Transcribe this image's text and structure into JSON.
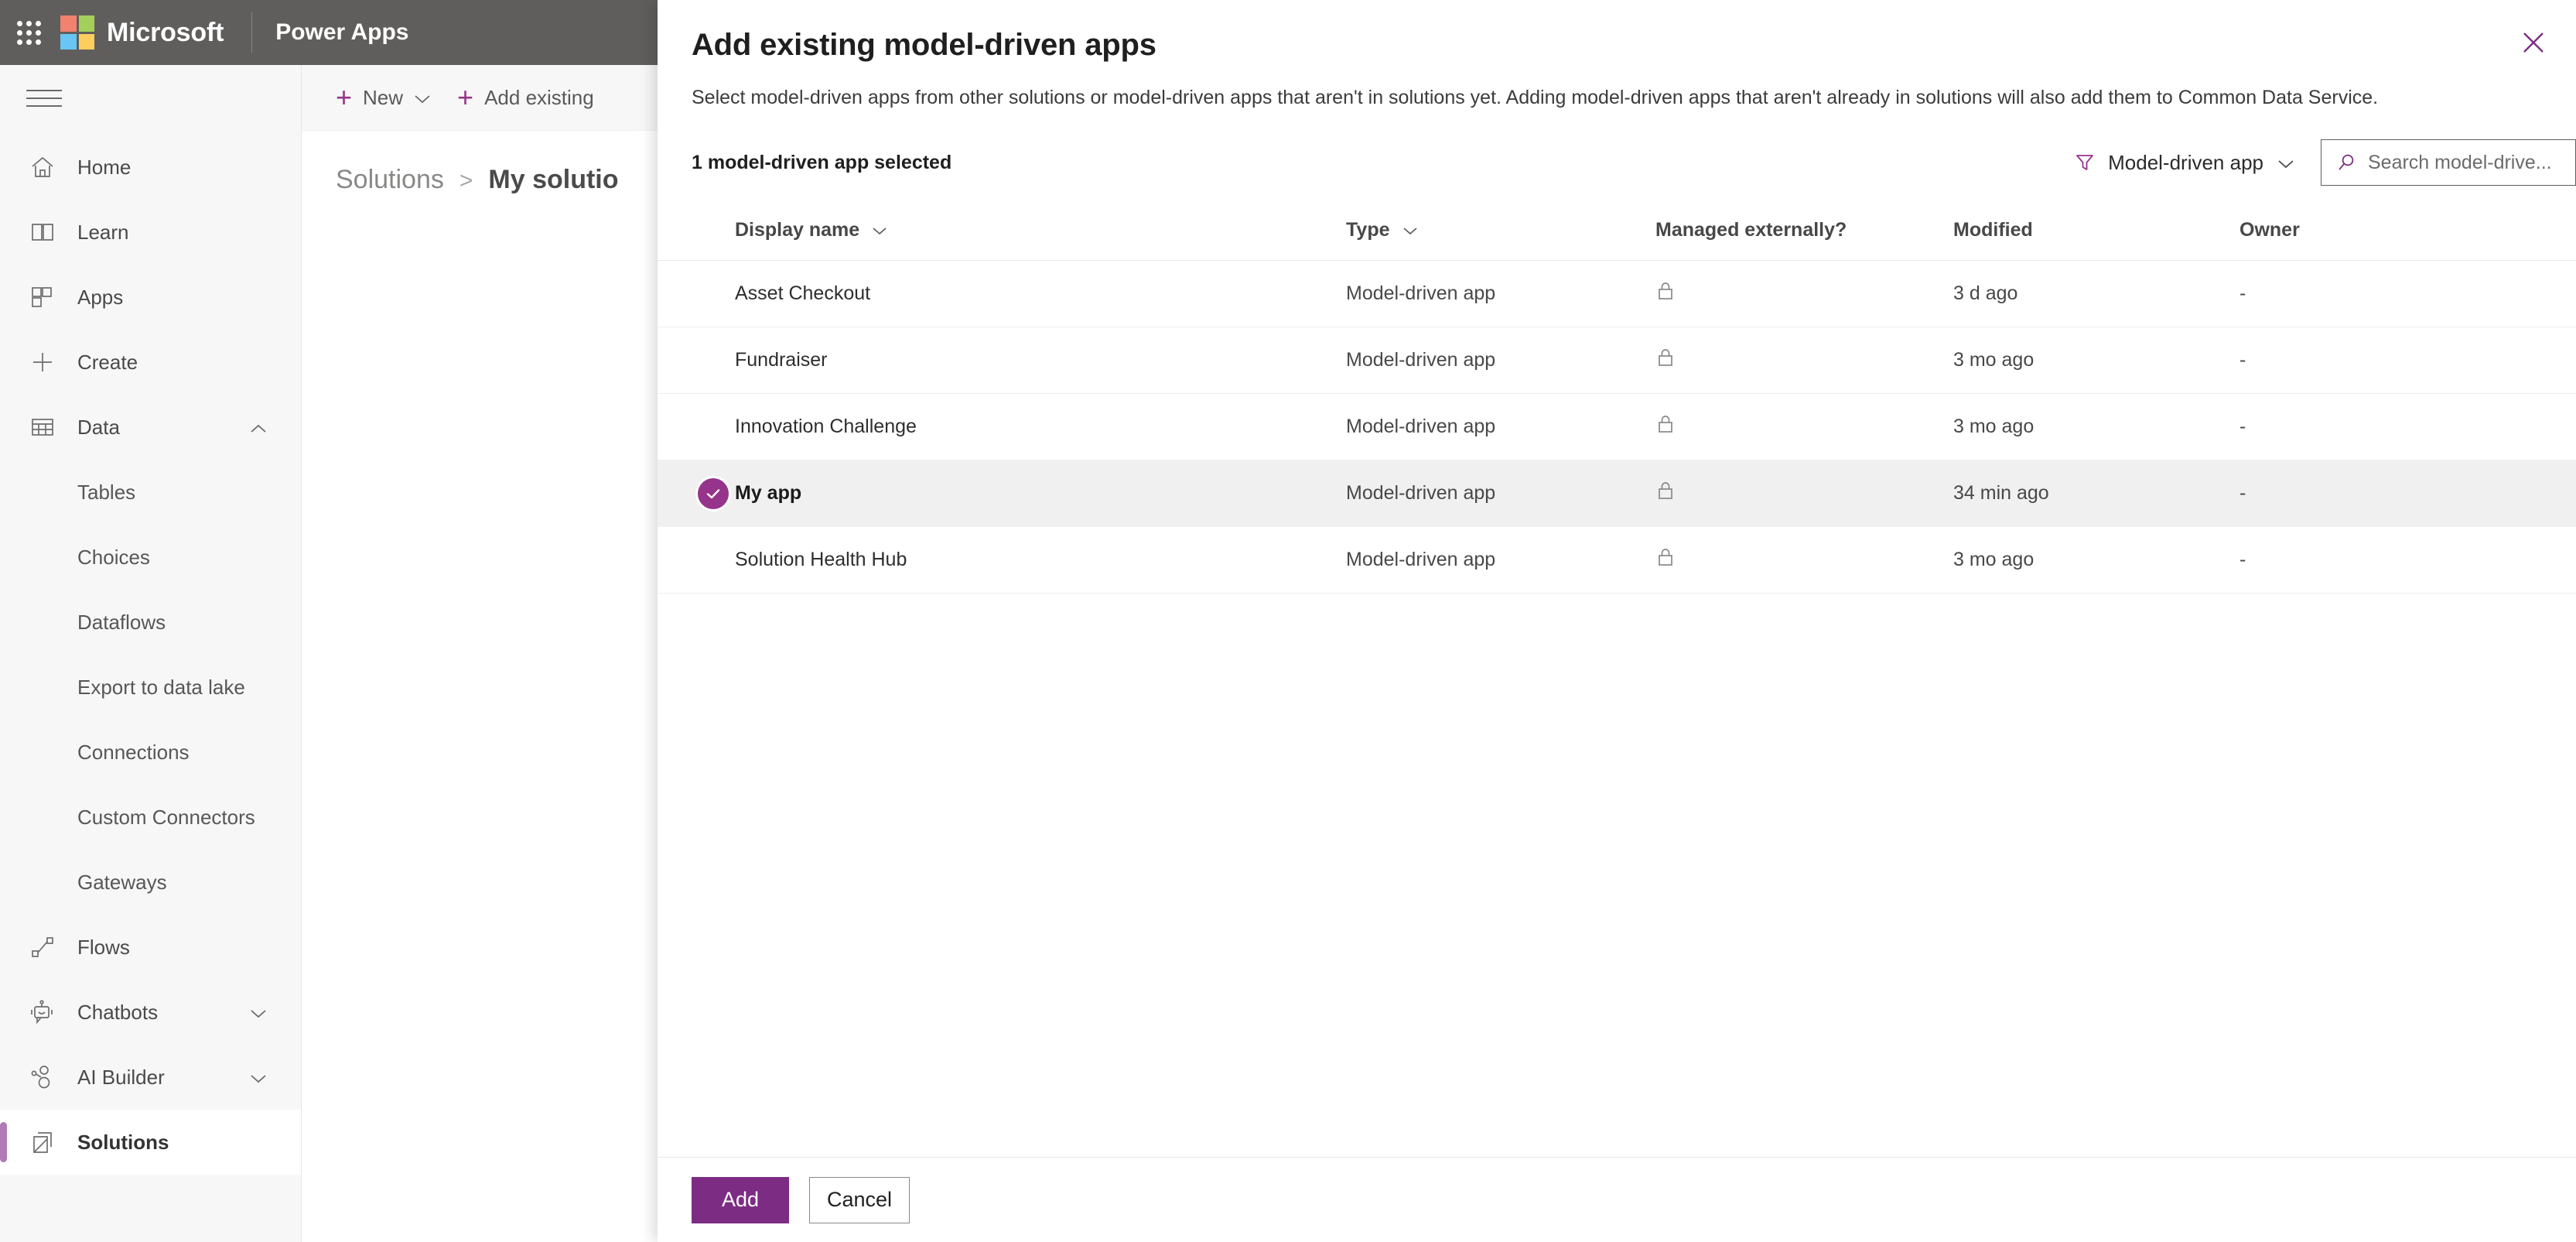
{
  "suite": {
    "waffle_icon": "waffle-icon",
    "brand": "Microsoft",
    "app_name": "Power Apps"
  },
  "leftnav": {
    "hamburger_icon": "hamburger-icon",
    "items": [
      {
        "label": "Home",
        "icon": "home-icon",
        "type": "top",
        "selected": false,
        "expandable": false
      },
      {
        "label": "Learn",
        "icon": "book-icon",
        "type": "top",
        "selected": false,
        "expandable": false
      },
      {
        "label": "Apps",
        "icon": "apps-icon",
        "type": "top",
        "selected": false,
        "expandable": false
      },
      {
        "label": "Create",
        "icon": "plus-icon",
        "type": "top",
        "selected": false,
        "expandable": false
      },
      {
        "label": "Data",
        "icon": "table-icon",
        "type": "top",
        "selected": false,
        "expandable": true,
        "expanded": true
      },
      {
        "label": "Tables",
        "icon": "",
        "type": "sub",
        "selected": false,
        "expandable": false
      },
      {
        "label": "Choices",
        "icon": "",
        "type": "sub",
        "selected": false,
        "expandable": false
      },
      {
        "label": "Dataflows",
        "icon": "",
        "type": "sub",
        "selected": false,
        "expandable": false
      },
      {
        "label": "Export to data lake",
        "icon": "",
        "type": "sub",
        "selected": false,
        "expandable": false
      },
      {
        "label": "Connections",
        "icon": "",
        "type": "sub",
        "selected": false,
        "expandable": false
      },
      {
        "label": "Custom Connectors",
        "icon": "",
        "type": "sub",
        "selected": false,
        "expandable": false
      },
      {
        "label": "Gateways",
        "icon": "",
        "type": "sub",
        "selected": false,
        "expandable": false
      },
      {
        "label": "Flows",
        "icon": "flow-icon",
        "type": "top",
        "selected": false,
        "expandable": false
      },
      {
        "label": "Chatbots",
        "icon": "chatbot-icon",
        "type": "top",
        "selected": false,
        "expandable": true,
        "expanded": false
      },
      {
        "label": "AI Builder",
        "icon": "ai-icon",
        "type": "top",
        "selected": false,
        "expandable": true,
        "expanded": false
      },
      {
        "label": "Solutions",
        "icon": "solutions-icon",
        "type": "top",
        "selected": true,
        "expandable": false
      }
    ]
  },
  "background": {
    "commands": [
      {
        "label": "New",
        "icon": "plus-icon",
        "has_chevron": true
      },
      {
        "label": "Add existing",
        "icon": "plus-icon",
        "has_chevron": false
      }
    ],
    "breadcrumb": {
      "root": "Solutions",
      "separator": ">",
      "current": "My solutio"
    }
  },
  "dialog": {
    "close_icon": "close-icon",
    "title": "Add existing model-driven apps",
    "description": "Select model-driven apps from other solutions or model-driven apps that aren't in solutions yet. Adding model-driven apps that aren't already in solutions will also add them to Common Data Service.",
    "selection_summary": "1 model-driven app selected",
    "filter": {
      "icon": "filter-icon",
      "label": "Model-driven app",
      "chevron": "chevron-down-icon"
    },
    "search": {
      "icon": "search-icon",
      "placeholder": "Search model-drive...",
      "value": ""
    },
    "grid": {
      "columns": [
        {
          "label": "Display name",
          "sortable": true
        },
        {
          "label": "Type",
          "sortable": true
        },
        {
          "label": "Managed externally?",
          "sortable": false
        },
        {
          "label": "Modified",
          "sortable": false
        },
        {
          "label": "Owner",
          "sortable": false
        }
      ],
      "rows": [
        {
          "display_name": "Asset Checkout",
          "type": "Model-driven app",
          "managed_externally": "lock-icon",
          "modified": "3 d ago",
          "owner": "-",
          "selected": false
        },
        {
          "display_name": "Fundraiser",
          "type": "Model-driven app",
          "managed_externally": "lock-icon",
          "modified": "3 mo ago",
          "owner": "-",
          "selected": false
        },
        {
          "display_name": "Innovation Challenge",
          "type": "Model-driven app",
          "managed_externally": "lock-icon",
          "modified": "3 mo ago",
          "owner": "-",
          "selected": false
        },
        {
          "display_name": "My app",
          "type": "Model-driven app",
          "managed_externally": "lock-icon",
          "modified": "34 min ago",
          "owner": "-",
          "selected": true
        },
        {
          "display_name": "Solution Health Hub",
          "type": "Model-driven app",
          "managed_externally": "lock-icon",
          "modified": "3 mo ago",
          "owner": "-",
          "selected": false
        }
      ]
    },
    "footer": {
      "primary": "Add",
      "secondary": "Cancel"
    }
  },
  "colors": {
    "brand_purple": "#7c2d83",
    "accent_purple": "#96348b",
    "nav_selected_bar": "#b07ab4",
    "suite_bar": "#605e5c",
    "row_selected_bg": "#f0f0f0"
  }
}
